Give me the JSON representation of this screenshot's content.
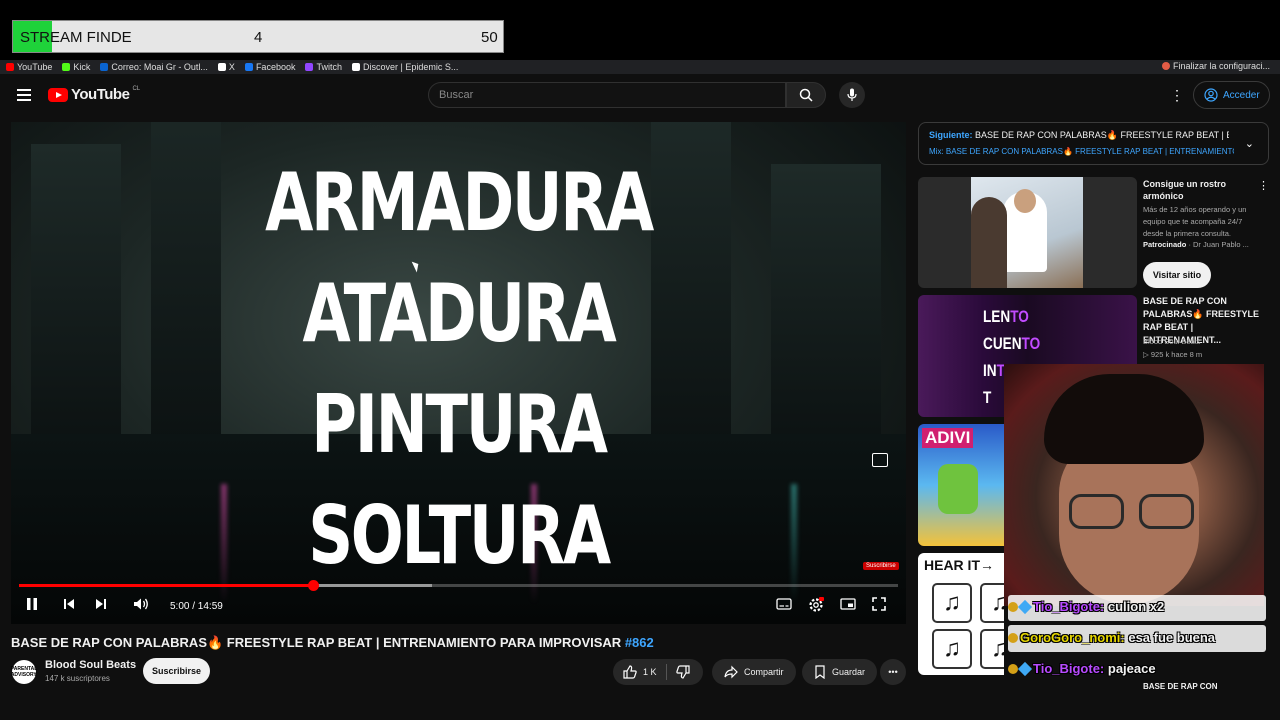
{
  "stream_overlay": {
    "label": "STREAM FINDE",
    "current": "4",
    "goal": "50",
    "fill_fraction": 0.08,
    "accent": "#1fd23a"
  },
  "bookmarks": [
    {
      "label": "YouTube",
      "icon": "youtube-icon",
      "color": "#ff0000"
    },
    {
      "label": "Kick",
      "icon": "kick-icon",
      "color": "#53fc18"
    },
    {
      "label": "Correo: Moai Gr - Outl...",
      "icon": "outlook-icon",
      "color": "#0a64d0"
    },
    {
      "label": "X",
      "icon": "x-icon",
      "color": "#ffffff"
    },
    {
      "label": "Facebook",
      "icon": "facebook-icon",
      "color": "#1877f2"
    },
    {
      "label": "Twitch",
      "icon": "twitch-icon",
      "color": "#9146ff"
    },
    {
      "label": "Discover | Epidemic S...",
      "icon": "epidemic-icon",
      "color": "#ffffff"
    }
  ],
  "bookmarks_right": "Finalizar la configuraci...",
  "masthead": {
    "logo_text": "YouTube",
    "country": "CL",
    "search_placeholder": "Buscar",
    "signin_label": "Acceder"
  },
  "player": {
    "lyrics": [
      "ARMADURA",
      "ATADURA",
      "PINTURA",
      "SOLTURA"
    ],
    "time": "5:00 / 14:59",
    "played_fraction": 0.334,
    "buffered_fraction": 0.47,
    "watermark": "Suscribirse"
  },
  "video": {
    "title": "BASE DE RAP CON PALABRAS🔥 FREESTYLE RAP BEAT | ENTRENAMIENTO PARA IMPROVISAR",
    "hashtag": "#862",
    "channel": "Blood Soul Beats",
    "subscribers": "147 k suscriptores",
    "subscribe_label": "Suscribirse",
    "likes": "1 K",
    "share_label": "Compartir",
    "save_label": "Guardar",
    "avatar_text": "PARENTAL ADVISORY"
  },
  "sidebar": {
    "up_next_prefix": "Siguiente:",
    "up_next_title": "BASE DE RAP CON PALABRAS🔥 FREESTYLE RAP BEAT | EN...",
    "up_next_mix": "Mix: BASE DE RAP CON PALABRAS🔥 FREESTYLE RAP BEAT | ENTRENAMIENTO PA...",
    "ad": {
      "title": "Consigue un rostro armónico",
      "description": "Más de 12 años operando y un equipo que te acompaña 24/7 desde la primera consulta.",
      "sponsored": "Patrocinado",
      "advertiser": "· Dr Juan Pablo ...",
      "cta": "Visitar sitio"
    },
    "video1": {
      "title": "BASE DE RAP CON PALABRAS🔥 FREESTYLE RAP BEAT | ENTRENAMIENT...",
      "channel": "Blood Soul Beats",
      "meta": "▷ 925 k   hace 8 m",
      "thumb_words": [
        "LEN",
        "TO",
        "CUEN",
        "TO",
        "IN",
        "TE",
        "T",
        ""
      ]
    },
    "video2_thumb": "ADIVI",
    "video3_thumb": "HEAR IT→",
    "bottom_fragment": "BASE DE RAP CON"
  },
  "chat": [
    {
      "user": "Tio_Bigote:",
      "message": "culion x2",
      "color": "#b84bff"
    },
    {
      "user": "GoroGoro_nomi:",
      "message": "esa fue buena",
      "color": "#e8d800"
    },
    {
      "user": "Tio_Bigote:",
      "message": "pajeace",
      "color": "#b84bff"
    }
  ]
}
